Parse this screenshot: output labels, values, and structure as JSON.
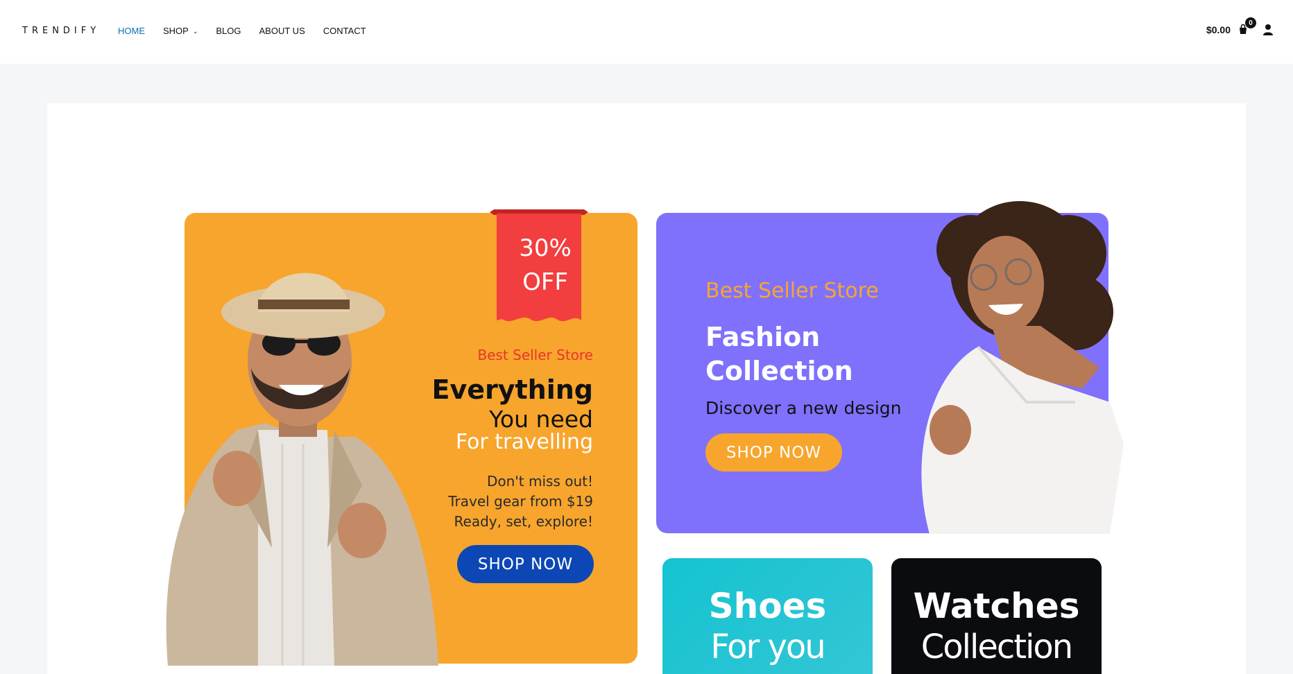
{
  "brand": {
    "logo": "TRENDIFY",
    "accent_color": "#0b6fb3"
  },
  "nav": {
    "items": [
      {
        "label": "HOME",
        "active": true
      },
      {
        "label": "SHOP",
        "has_dropdown": true
      },
      {
        "label": "BLOG"
      },
      {
        "label": "ABOUT US"
      },
      {
        "label": "CONTACT"
      }
    ]
  },
  "header_right": {
    "cart_total": "$0.00",
    "cart_count": "0",
    "cart_icon": "shopping-bag-icon",
    "user_icon": "user-icon"
  },
  "promo_orange": {
    "badge_line1": "30%",
    "badge_line2": "OFF",
    "store_label": "Best Seller Store",
    "headline1": "Everything",
    "headline2": "You need",
    "headline3": "For travelling",
    "line1": "Don't miss out!",
    "line2": "Travel gear from $19",
    "line3": "Ready, set, explore!",
    "button": "SHOP NOW",
    "bg_color": "#f7a52d",
    "button_color": "#0d47b6",
    "ribbon_color": "#f23e3e"
  },
  "promo_purple": {
    "store_label": "Best Seller Store",
    "title_line1": "Fashion",
    "title_line2": "Collection",
    "subtitle": "Discover a new design",
    "button": "SHOP NOW",
    "bg_color": "#7f71fb"
  },
  "promo_shoes": {
    "title": "Shoes",
    "subtitle": "For you",
    "bg_color": "#14c3d1"
  },
  "promo_watches": {
    "title": "Watches",
    "subtitle": "Collection",
    "bg_color": "#0a0c10"
  }
}
